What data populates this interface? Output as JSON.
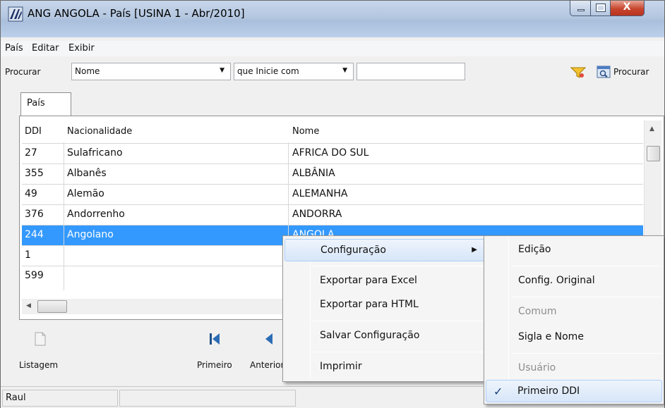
{
  "window": {
    "title": "ANG ANGOLA -  País [USINA 1 - Abr/2010]",
    "close_glyph": "X"
  },
  "menubar": [
    "País",
    "Editar",
    "Exibir"
  ],
  "search": {
    "label": "Procurar",
    "field_value": "Nome",
    "mode_value": "que Inicie com",
    "text_value": "",
    "search_button_label": "Procurar"
  },
  "tab_label": "País",
  "grid": {
    "headers": [
      "DDI",
      "Nacionalidade",
      "Nome"
    ],
    "rows": [
      {
        "ddi": "27",
        "nacionalidade": "Sulafricano",
        "nome": "AFRICA DO SUL"
      },
      {
        "ddi": "355",
        "nacionalidade": "Albanês",
        "nome": "ALBÂNIA"
      },
      {
        "ddi": "49",
        "nacionalidade": "Alemão",
        "nome": "ALEMANHA"
      },
      {
        "ddi": "376",
        "nacionalidade": "Andorrenho",
        "nome": "ANDORRA"
      },
      {
        "ddi": "244",
        "nacionalidade": "Angolano",
        "nome": "ANGOLA"
      },
      {
        "ddi": "1",
        "nacionalidade": "",
        "nome": ""
      },
      {
        "ddi": "599",
        "nacionalidade": "",
        "nome": ""
      }
    ],
    "selected_row": 4
  },
  "nav_buttons": [
    {
      "label": "Listagem",
      "icon": "document-icon"
    },
    {
      "label": "Primeiro",
      "icon": "first-record-icon"
    },
    {
      "label": "Anterior",
      "icon": "previous-record-icon"
    }
  ],
  "status": {
    "user": "Raul"
  },
  "context_menu": {
    "items": [
      "Configuração",
      "Exportar para Excel",
      "Exportar para HTML",
      "Salvar Configuração",
      "Imprimir"
    ]
  },
  "submenu": {
    "items": [
      "Edição",
      "Config. Original",
      "Comum",
      "Sigla e Nome",
      "Usuário",
      "Primeiro DDI"
    ],
    "check_glyph": "✓"
  },
  "colors": {
    "selection": "#3399ff",
    "titlebar": "#b4c7e0",
    "close_button": "#c7452d"
  }
}
